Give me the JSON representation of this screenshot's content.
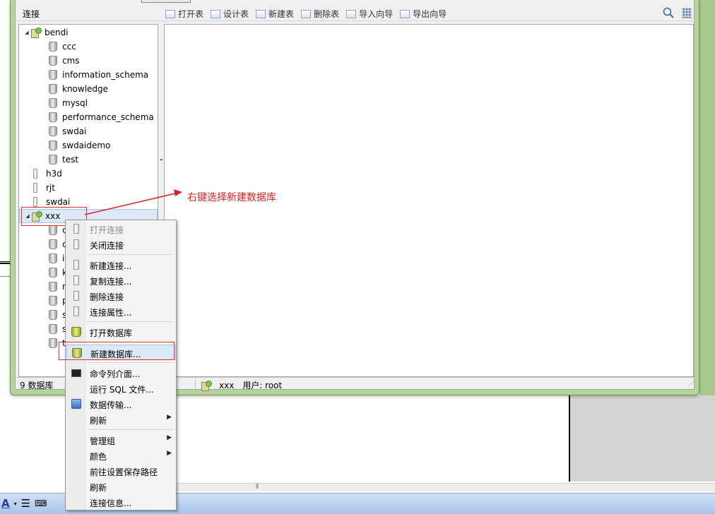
{
  "toolbar": {
    "connections_title": "连接",
    "actions": [
      {
        "label": "打开表",
        "icon": "open-table-icon"
      },
      {
        "label": "设计表",
        "icon": "design-table-icon"
      },
      {
        "label": "新建表",
        "icon": "new-table-icon"
      },
      {
        "label": "删除表",
        "icon": "delete-table-icon"
      },
      {
        "label": "导入向导",
        "icon": "import-wizard-icon"
      },
      {
        "label": "导出向导",
        "icon": "export-wizard-icon"
      }
    ],
    "right_icons": [
      "search-icon",
      "grid-view-icon"
    ]
  },
  "tree": {
    "connections": [
      {
        "name": "bendi",
        "state": "open",
        "databases": [
          "ccc",
          "cms",
          "information_schema",
          "knowledge",
          "mysql",
          "performance_schema",
          "swdai",
          "swdaidemo",
          "test"
        ]
      },
      {
        "name": "h3d",
        "state": "closed"
      },
      {
        "name": "rjt",
        "state": "closed"
      },
      {
        "name": "swdai",
        "state": "closed"
      },
      {
        "name": "xxx",
        "state": "open",
        "selected": true,
        "hidden_db_initials": [
          "c",
          "c",
          "i",
          "k",
          "r",
          "p",
          "s",
          "s",
          "t"
        ]
      }
    ]
  },
  "status": {
    "db_count": "9 数据库",
    "connection": "xxx",
    "user": "用户: root"
  },
  "annotation": {
    "text": "右键选择新建数据库",
    "color": "#e02020"
  },
  "context_menu": {
    "groups": [
      [
        {
          "label": "打开连接",
          "disabled": true,
          "icon": "open-connection-icon"
        },
        {
          "label": "关闭连接",
          "icon": "close-connection-icon"
        }
      ],
      [
        {
          "label": "新建连接...",
          "icon": "new-connection-icon"
        },
        {
          "label": "复制连接...",
          "icon": "duplicate-connection-icon"
        },
        {
          "label": "删除连接",
          "icon": "delete-connection-icon"
        },
        {
          "label": "连接属性...",
          "icon": "connection-properties-icon"
        }
      ],
      [
        {
          "label": "打开数据库",
          "icon": "open-database-icon"
        }
      ],
      [
        {
          "label": "新建数据库...",
          "icon": "new-database-icon",
          "highlighted": true
        }
      ],
      [
        {
          "label": "命令列介面...",
          "icon": "console-icon"
        },
        {
          "label": "运行 SQL 文件...",
          "icon": ""
        },
        {
          "label": "数据传输...",
          "icon": "data-transfer-icon"
        },
        {
          "label": "刷新",
          "submenu": true,
          "icon": ""
        }
      ],
      [
        {
          "label": "管理组",
          "submenu": true,
          "icon": ""
        },
        {
          "label": "颜色",
          "submenu": true,
          "icon": ""
        },
        {
          "label": "前往设置保存路径",
          "icon": ""
        },
        {
          "label": "刷新",
          "icon": ""
        },
        {
          "label": "连接信息...",
          "icon": ""
        }
      ]
    ]
  },
  "colors": {
    "window_frame": "#b6d59a",
    "selection": "#dde8f6",
    "highlight_box": "#e03030"
  }
}
